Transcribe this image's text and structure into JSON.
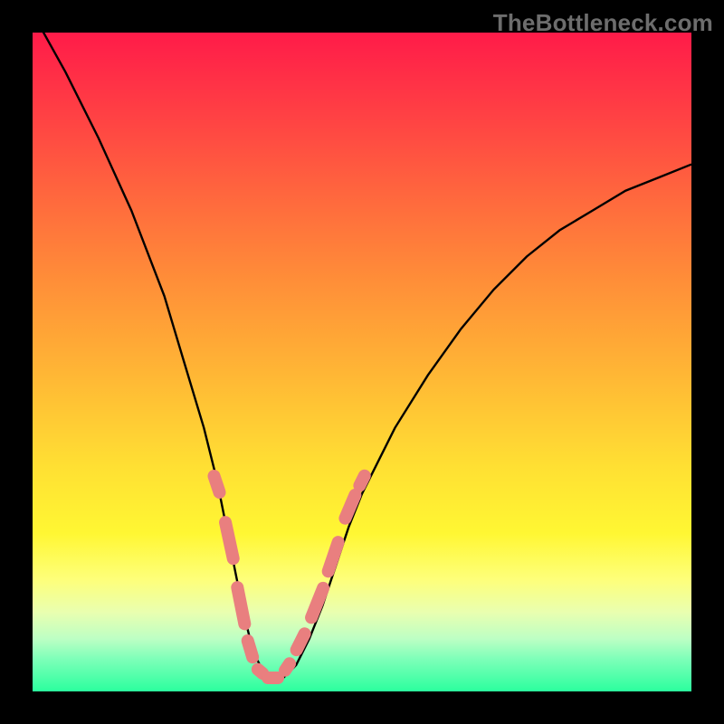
{
  "watermark": "TheBottleneck.com",
  "colors": {
    "frame": "#000000",
    "gradient_top": "#ff1b49",
    "gradient_bottom": "#2bff9e",
    "curve": "#000000",
    "markers": "#e97f7f"
  },
  "chart_data": {
    "type": "line",
    "title": "",
    "xlabel": "",
    "ylabel": "",
    "xlim": [
      0,
      100
    ],
    "ylim": [
      0,
      100
    ],
    "x": [
      0,
      5,
      10,
      15,
      20,
      23,
      26,
      28,
      30,
      31,
      32,
      33,
      34,
      35,
      36,
      37,
      38,
      39,
      40,
      42,
      44,
      46,
      48,
      50,
      55,
      60,
      65,
      70,
      75,
      80,
      85,
      90,
      95,
      100
    ],
    "values": [
      103,
      94,
      84,
      73,
      60,
      50,
      40,
      32,
      22,
      17,
      12,
      8,
      5,
      3,
      2,
      2,
      2,
      3,
      4,
      8,
      13,
      19,
      25,
      30,
      40,
      48,
      55,
      61,
      66,
      70,
      73,
      76,
      78,
      80
    ],
    "annotations": {
      "marker_segments_left": [
        {
          "x_start": 27.5,
          "x_end": 28.5,
          "y_start": 33,
          "y_end": 30
        },
        {
          "x_start": 29.2,
          "x_end": 30.5,
          "y_start": 26,
          "y_end": 20
        },
        {
          "x_start": 31.0,
          "x_end": 32.2,
          "y_start": 16,
          "y_end": 10
        },
        {
          "x_start": 32.6,
          "x_end": 33.5,
          "y_start": 8,
          "y_end": 5
        },
        {
          "x_start": 34.0,
          "x_end": 35.2,
          "y_start": 3.5,
          "y_end": 2.5
        },
        {
          "x_start": 35.5,
          "x_end": 37.5,
          "y_start": 2,
          "y_end": 2
        }
      ],
      "marker_segments_right": [
        {
          "x_start": 38.2,
          "x_end": 39.2,
          "y_start": 3,
          "y_end": 4.5
        },
        {
          "x_start": 40.0,
          "x_end": 41.5,
          "y_start": 6,
          "y_end": 9
        },
        {
          "x_start": 42.2,
          "x_end": 44.2,
          "y_start": 11,
          "y_end": 16
        },
        {
          "x_start": 44.8,
          "x_end": 46.5,
          "y_start": 18,
          "y_end": 23
        },
        {
          "x_start": 47.3,
          "x_end": 49.0,
          "y_start": 26,
          "y_end": 30
        },
        {
          "x_start": 49.5,
          "x_end": 50.5,
          "y_start": 31,
          "y_end": 33
        }
      ]
    }
  }
}
